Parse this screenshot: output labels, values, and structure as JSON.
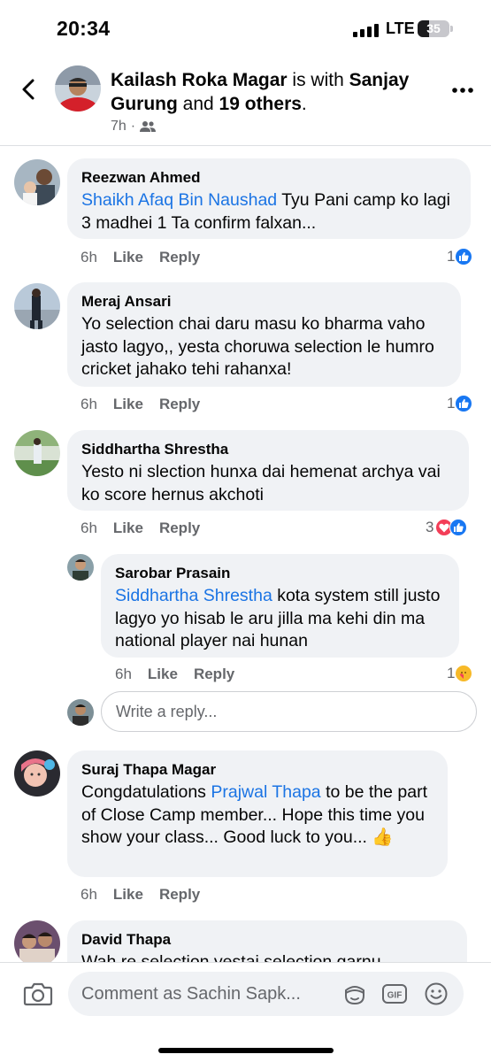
{
  "status_bar": {
    "time": "20:34",
    "network": "LTE",
    "battery": "35",
    "battery_level": 0.35
  },
  "header": {
    "author": "Kailash Roka Magar",
    "with_text": " is with ",
    "tagged": "Sanjay Gurung",
    "and_text": " and ",
    "others": "19 others",
    "period": ".",
    "time": "7h",
    "separator": "·",
    "audience_icon": "friends-icon"
  },
  "comments": [
    {
      "author": "Reezwan Ahmed",
      "tag": "Shaikh Afaq Bin Naushad",
      "text": " Tyu Pani camp ko lagi 3 madhei 1 Ta confirm falxan...",
      "time": "6h",
      "like": "Like",
      "reply": "Reply",
      "reactions": "1"
    },
    {
      "author": "Meraj Ansari",
      "text": "Yo selection chai daru masu ko bharma vaho jasto lagyo,, yesta choruwa selection le humro cricket jahako tehi rahanxa!",
      "time": "6h",
      "like": "Like",
      "reply": "Reply",
      "reactions": "1"
    },
    {
      "author": "Siddhartha Shrestha",
      "text": "Yesto ni slection hunxa dai hemenat archya vai ko score hernus akchoti",
      "time": "6h",
      "like": "Like",
      "reply": "Reply",
      "reactions": "3"
    },
    {
      "author": "Sarobar Prasain",
      "tag": "Siddhartha Shrestha",
      "text": " kota system still justo lagyo yo hisab le aru jilla ma kehi din ma national player nai hunan",
      "time": "6h",
      "like": "Like",
      "reply": "Reply",
      "reactions": "1"
    },
    {
      "author": "Suraj Thapa Magar",
      "text_before": "Congdatulations ",
      "tag": "Prajwal Thapa",
      "text": " to be the part of Close Camp member... Hope this time you show your class... Good luck to you... 👍",
      "time": "6h",
      "like": "Like",
      "reply": "Reply"
    },
    {
      "author": "David Thapa",
      "text": "Wah re selection yestai selection garnu"
    }
  ],
  "reply_field": {
    "placeholder": "Write a reply..."
  },
  "composer": {
    "placeholder": "Comment as Sachin Sapk...",
    "gif_label": "GIF"
  },
  "colors": {
    "link": "#1b74e4",
    "like_blue": "#1877f2",
    "love_red": "#f33e58",
    "bubble_bg": "#f0f2f5",
    "meta_gray": "#65676b"
  }
}
